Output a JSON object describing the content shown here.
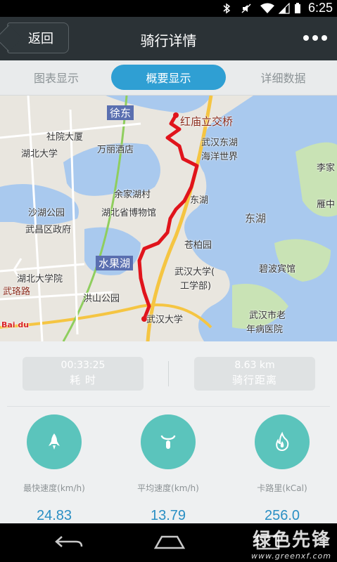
{
  "status_bar": {
    "time": "6:25"
  },
  "header": {
    "back_label": "返回",
    "title": "骑行详情"
  },
  "tabs": [
    {
      "label": "图表显示"
    },
    {
      "label": "概要显示",
      "active": true
    },
    {
      "label": "详细数据"
    }
  ],
  "map": {
    "labels": [
      "徐东",
      "红庙立交桥",
      "社院大厦",
      "万丽酒店",
      "湖北大学",
      "武汉东湖",
      "海洋世界",
      "余家湖村",
      "湖北省博物馆",
      "东湖",
      "东湖",
      "沙湖公园",
      "武昌区政府",
      "苍柏园",
      "水果湖",
      "湖北大学院",
      "武汉大学(",
      "工学部)",
      "碧波宾馆",
      "武珞路",
      "洪山公园",
      "武汉大学",
      "武汉市老",
      "年病医院",
      "李家",
      "雁中"
    ],
    "baidu_logo": "Bai du"
  },
  "summary": {
    "duration_value": "00:33:25",
    "duration_label": "耗  时",
    "distance_value": "8.63 km",
    "distance_label": "骑行距离"
  },
  "metrics": [
    {
      "label": "最快速度(km/h)",
      "value": "24.83",
      "icon": "rocket-icon"
    },
    {
      "label": "平均速度(km/h)",
      "value": "13.79",
      "icon": "bicycle-icon"
    },
    {
      "label": "卡路里(kCal)",
      "value": "256.0",
      "icon": "flame-icon"
    }
  ],
  "watermark": {
    "title": "绿色先锋",
    "url": "www.greenxf.com"
  },
  "colors": {
    "accent": "#2f9fd3",
    "metric_circle": "#5bc4bc",
    "metric_value": "#2a8fc4",
    "route": "#e0141c"
  }
}
